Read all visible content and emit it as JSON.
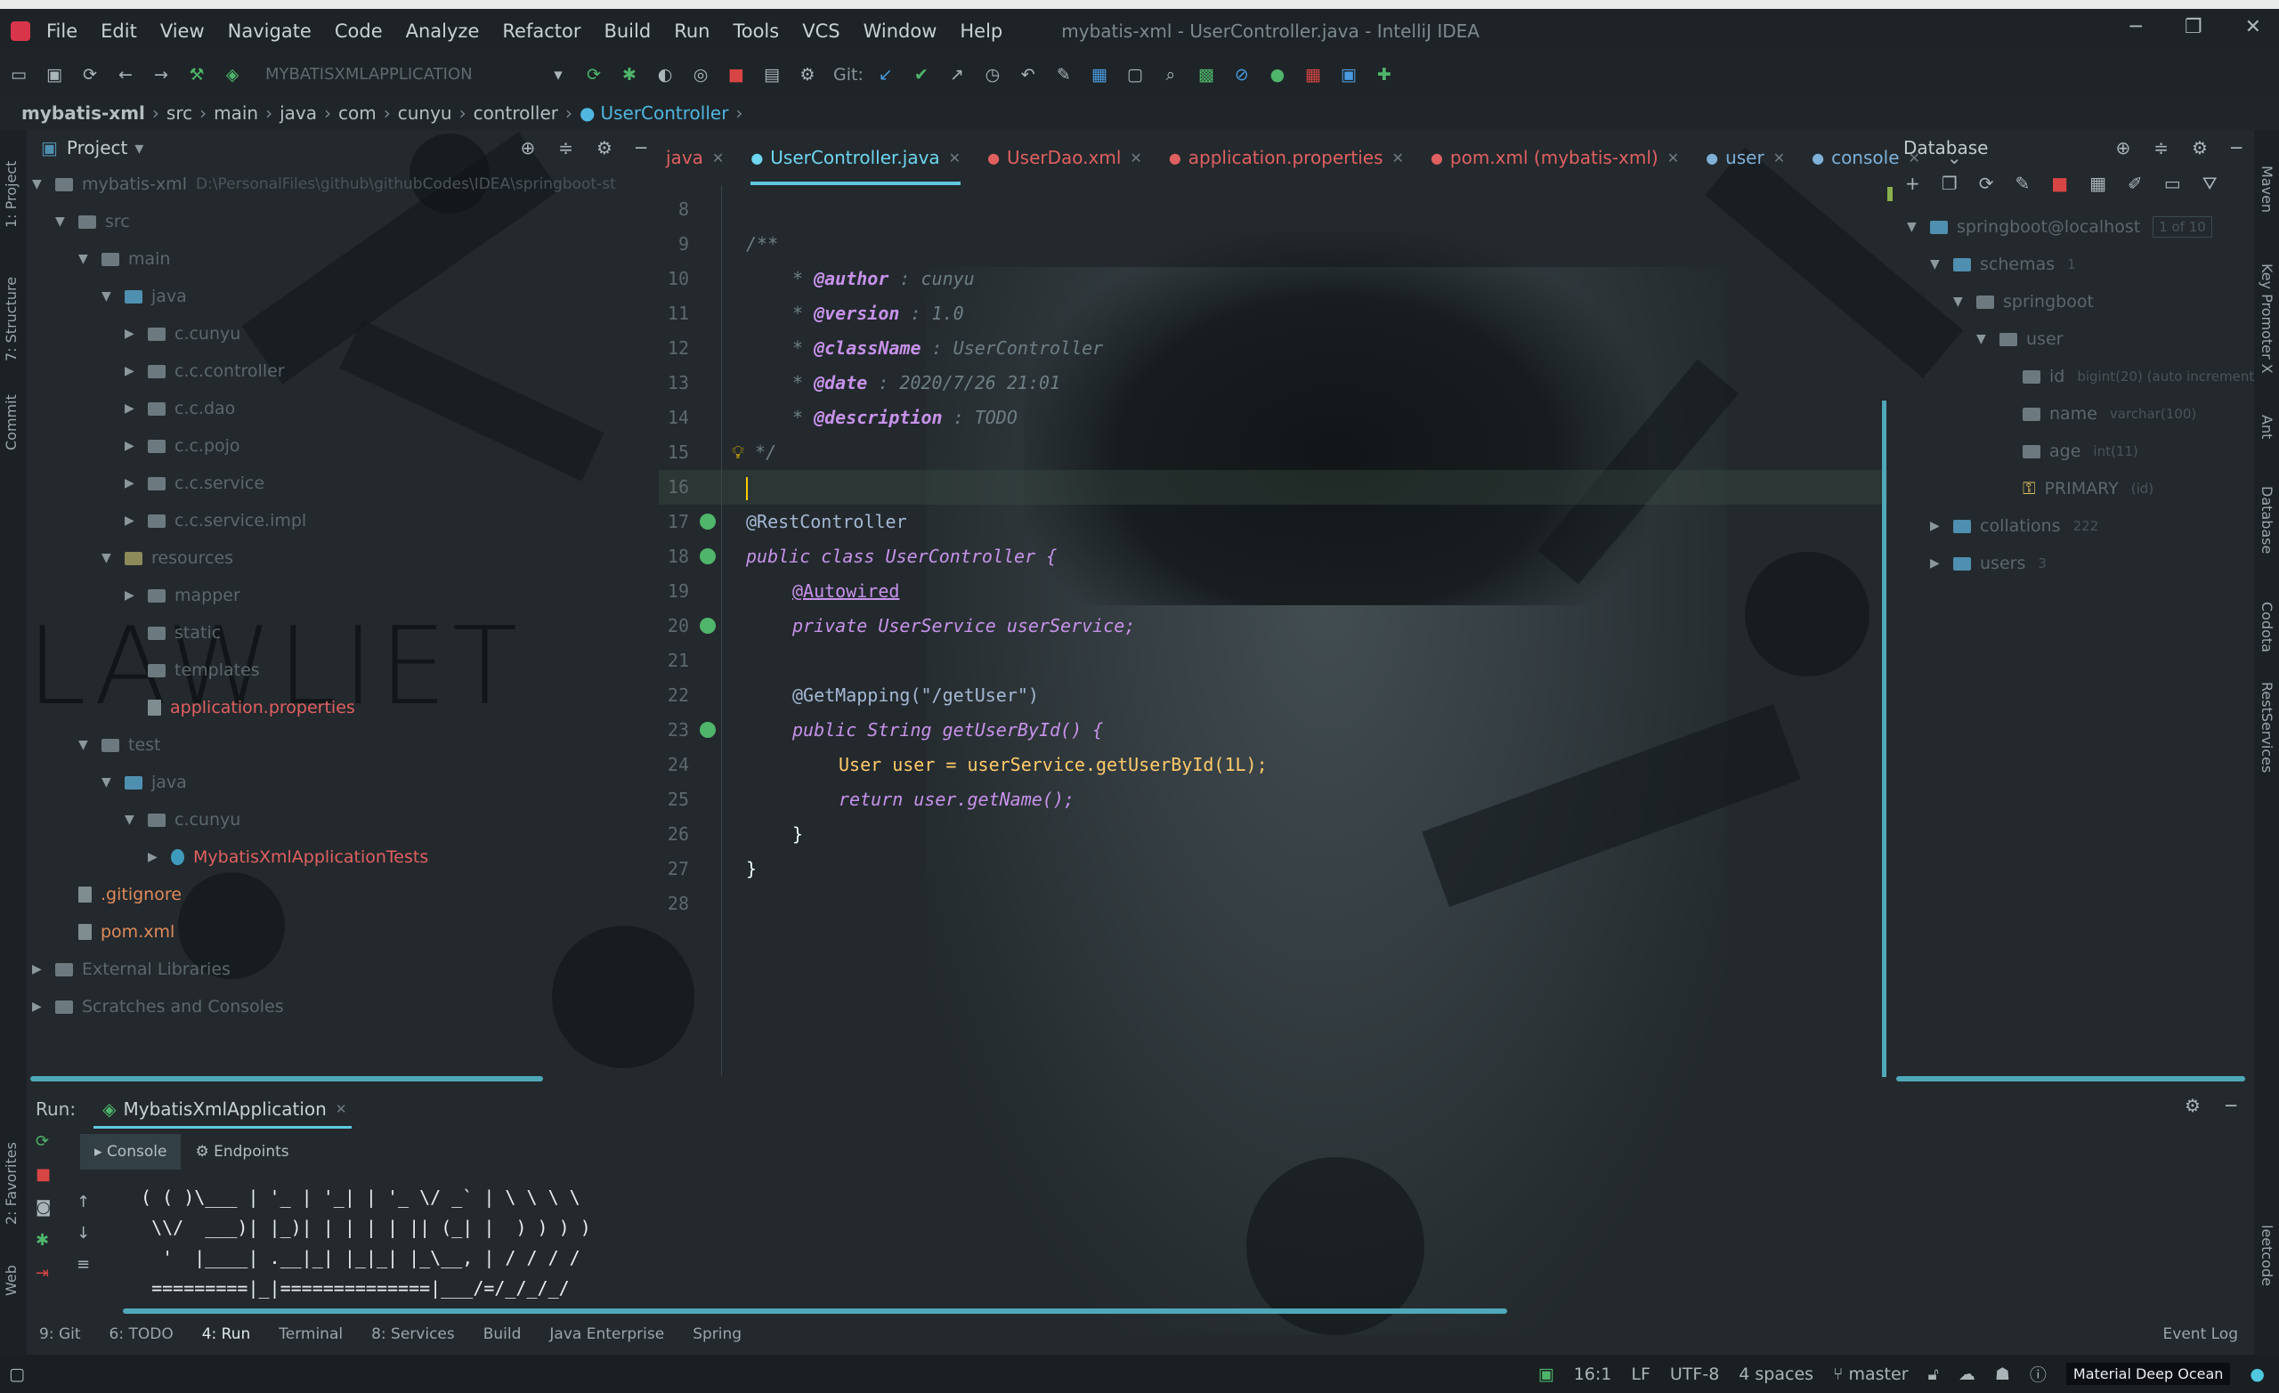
{
  "window": {
    "title": "mybatis-xml - UserController.java - IntelliJ IDEA"
  },
  "menu": [
    "File",
    "Edit",
    "View",
    "Navigate",
    "Code",
    "Analyze",
    "Refactor",
    "Build",
    "Run",
    "Tools",
    "VCS",
    "Window",
    "Help"
  ],
  "toolbar": {
    "run_config": "MYBATISXMLAPPLICATION",
    "git_label": "Git:"
  },
  "breadcrumb": [
    "mybatis-xml",
    "src",
    "main",
    "java",
    "com",
    "cunyu",
    "controller",
    "UserController"
  ],
  "left_strip": [
    "1: Project",
    "7: Structure",
    "Commit",
    "2: Favorites",
    "Web"
  ],
  "right_strip": [
    "Maven",
    "Key Promoter X",
    "Ant",
    "Database",
    "Codota",
    "RestServices",
    "leetcode"
  ],
  "project": {
    "header": "Project",
    "tree": [
      {
        "label": "mybatis-xml",
        "extra": "D:\\PersonalFiles\\github\\githubCodes\\IDEA\\springboot-st",
        "depth": 0,
        "kind": "module",
        "style": "dim"
      },
      {
        "label": "src",
        "depth": 1,
        "kind": "folder",
        "style": "dim"
      },
      {
        "label": "main",
        "depth": 2,
        "kind": "folder",
        "style": "dim"
      },
      {
        "label": "java",
        "depth": 3,
        "kind": "folder-blue",
        "style": "dim"
      },
      {
        "label": "c.cunyu",
        "depth": 4,
        "kind": "folder",
        "style": "dim"
      },
      {
        "label": "c.c.controller",
        "depth": 4,
        "kind": "folder",
        "style": "dim"
      },
      {
        "label": "c.c.dao",
        "depth": 4,
        "kind": "folder",
        "style": "dim"
      },
      {
        "label": "c.c.pojo",
        "depth": 4,
        "kind": "folder",
        "style": "dim"
      },
      {
        "label": "c.c.service",
        "depth": 4,
        "kind": "folder",
        "style": "dim"
      },
      {
        "label": "c.c.service.impl",
        "depth": 4,
        "kind": "folder",
        "style": "dim"
      },
      {
        "label": "resources",
        "depth": 3,
        "kind": "folder-yellow",
        "style": "dim"
      },
      {
        "label": "mapper",
        "depth": 4,
        "kind": "folder",
        "style": "dim"
      },
      {
        "label": "static",
        "depth": 4,
        "kind": "folder",
        "style": "dim"
      },
      {
        "label": "templates",
        "depth": 4,
        "kind": "folder",
        "style": "dim"
      },
      {
        "label": "application.properties",
        "depth": 4,
        "kind": "file",
        "style": "red"
      },
      {
        "label": "test",
        "depth": 2,
        "kind": "folder",
        "style": "dim"
      },
      {
        "label": "java",
        "depth": 3,
        "kind": "folder-blue",
        "style": "dim"
      },
      {
        "label": "c.cunyu",
        "depth": 4,
        "kind": "folder",
        "style": "dim"
      },
      {
        "label": "MybatisXmlApplicationTests",
        "depth": 5,
        "kind": "class",
        "style": "red"
      },
      {
        "label": ".gitignore",
        "depth": 1,
        "kind": "file",
        "style": "orange"
      },
      {
        "label": "pom.xml",
        "depth": 1,
        "kind": "file",
        "style": "orange"
      },
      {
        "label": "External Libraries",
        "depth": 0,
        "kind": "folder",
        "style": "dim"
      },
      {
        "label": "Scratches and Consoles",
        "depth": 0,
        "kind": "folder",
        "style": "dim"
      }
    ]
  },
  "editor_tabs": [
    {
      "label": "java",
      "active": false,
      "color": "#e06060"
    },
    {
      "label": "UserController.java",
      "active": true,
      "color": "#6ed6f0"
    },
    {
      "label": "UserDao.xml",
      "active": false,
      "color": "#e06060"
    },
    {
      "label": "application.properties",
      "active": false,
      "color": "#e06060"
    },
    {
      "label": "pom.xml (mybatis-xml)",
      "active": false,
      "color": "#e06060"
    },
    {
      "label": "user",
      "active": false,
      "color": "#7eb0d8"
    },
    {
      "label": "console",
      "active": false,
      "color": "#7eb0d8"
    }
  ],
  "code_lines": [
    {
      "n": "8",
      "text": ""
    },
    {
      "n": "9",
      "text": "/**"
    },
    {
      "n": "10",
      "tag": "@author",
      "val": " : cunyu"
    },
    {
      "n": "11",
      "tag": "@version",
      "val": " : 1.0"
    },
    {
      "n": "12",
      "tag": "@className",
      "val": " : UserController"
    },
    {
      "n": "13",
      "tag": "@date",
      "val": " : 2020/7/26 21:01"
    },
    {
      "n": "14",
      "tag": "@description",
      "val": " : TODO"
    },
    {
      "n": "15",
      "text": " */"
    },
    {
      "n": "16",
      "text": ""
    },
    {
      "n": "17",
      "text": "@RestController"
    },
    {
      "n": "18",
      "text": "public class UserController {"
    },
    {
      "n": "19",
      "text": "@Autowired"
    },
    {
      "n": "20",
      "text": "private UserService userService;"
    },
    {
      "n": "21",
      "text": ""
    },
    {
      "n": "22",
      "text": "@GetMapping(\"/getUser\")"
    },
    {
      "n": "23",
      "text": "public String getUserById() {"
    },
    {
      "n": "24",
      "text": "User user = userService.getUserById(1L);"
    },
    {
      "n": "25",
      "text": "return user.getName();"
    },
    {
      "n": "26",
      "text": "}"
    },
    {
      "n": "27",
      "text": "}"
    },
    {
      "n": "28",
      "text": ""
    }
  ],
  "database": {
    "header": "Database",
    "tree": [
      {
        "label": "springboot@localhost",
        "extra": "1 of 10",
        "depth": 0
      },
      {
        "label": "schemas",
        "extra": "1",
        "depth": 1
      },
      {
        "label": "springboot",
        "extra": "",
        "depth": 2
      },
      {
        "label": "user",
        "extra": "",
        "depth": 3
      },
      {
        "label": "id",
        "extra": "bigint(20) (auto increment",
        "depth": 4
      },
      {
        "label": "name",
        "extra": "varchar(100)",
        "depth": 4
      },
      {
        "label": "age",
        "extra": "int(11)",
        "depth": 4
      },
      {
        "label": "PRIMARY",
        "extra": "(id)",
        "depth": 4
      },
      {
        "label": "collations",
        "extra": "222",
        "depth": 1
      },
      {
        "label": "users",
        "extra": "3",
        "depth": 1
      }
    ]
  },
  "run": {
    "label": "Run:",
    "config": "MybatisXmlApplication",
    "subtabs": [
      "Console",
      "Endpoints"
    ],
    "console": [
      " ( ( )\\___ | '_ | '_| | '_ \\/ _` | \\ \\ \\ \\",
      "  \\\\/  ___)| |_)| | | | | || (_| |  ) ) ) )",
      "   '  |____| .__|_| |_|_| |_\\__, | / / / /",
      "  =========|_|==============|___/=/_/_/_/"
    ]
  },
  "tool_windows": [
    "9: Git",
    "6: TODO",
    "4: Run",
    "Terminal",
    "8: Services",
    "Build",
    "Java Enterprise",
    "Spring",
    "Event Log"
  ],
  "status": {
    "position": "16:1",
    "line_sep": "LF",
    "encoding": "UTF-8",
    "indent": "4 spaces",
    "branch": "master",
    "theme": "Material Deep Ocean"
  }
}
